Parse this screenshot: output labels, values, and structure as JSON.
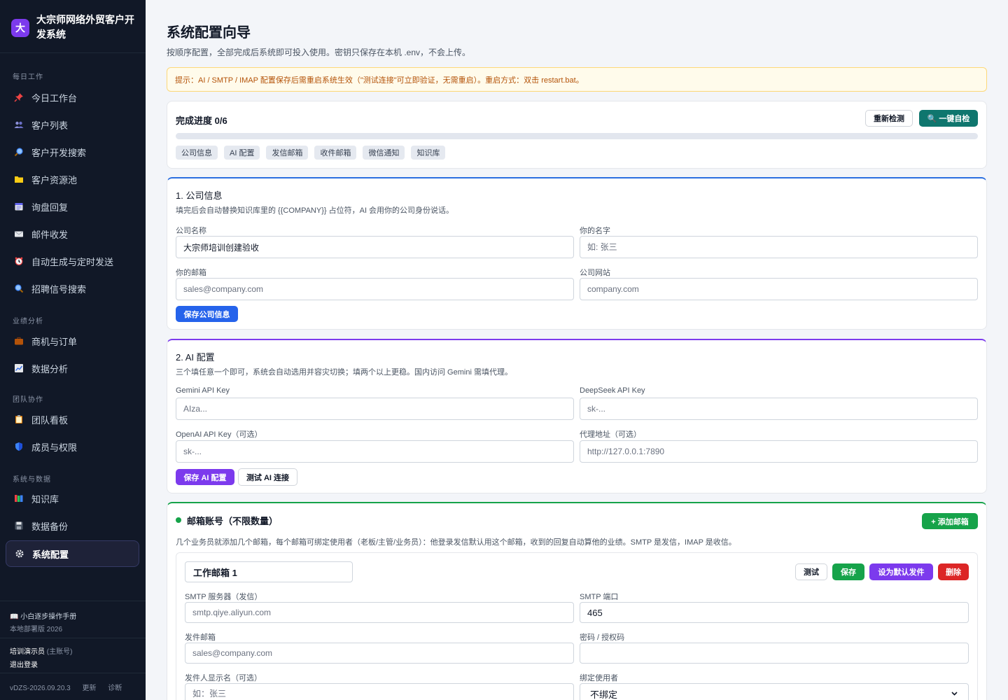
{
  "sidebar": {
    "logo_char": "大",
    "app_title": "大宗师网络外贸客户开发系统",
    "groups": [
      {
        "title": "每日工作",
        "items": [
          "今日工作台",
          "客户列表",
          "客户开发搜索",
          "客户资源池",
          "询盘回复",
          "邮件收发",
          "自动生成与定时发送",
          "招聘信号搜索"
        ]
      },
      {
        "title": "业绩分析",
        "items": [
          "商机与订单",
          "数据分析"
        ]
      },
      {
        "title": "团队协作",
        "items": [
          "团队看板",
          "成员与权限"
        ]
      },
      {
        "title": "系统与数据",
        "items": [
          "知识库",
          "数据备份",
          "系统配置"
        ]
      }
    ],
    "active_item": "系统配置",
    "manual": "📖 小白逐步操作手册",
    "edition": "本地部署版 2026",
    "user_name": "培训演示员",
    "user_role": "(主账号)",
    "logout": "退出登录",
    "version": "vDZS-2026.09.20.3",
    "update": "更新",
    "diagnose": "诊断"
  },
  "header": {
    "title": "系统配置向导",
    "subtitle": "按顺序配置，全部完成后系统即可投入使用。密钥只保存在本机 .env，不会上传。",
    "tip": "提示：AI / SMTP / IMAP 配置保存后需重启系统生效（\"测试连接\"可立即验证，无需重启）。重启方式：双击 restart.bat。"
  },
  "progress": {
    "label": "完成进度 0/6",
    "percent": 0,
    "recheck": "重新检测",
    "self_check": "🔍 一键自检",
    "steps": [
      "公司信息",
      "AI 配置",
      "发信邮箱",
      "收件邮箱",
      "微信通知",
      "知识库"
    ]
  },
  "company": {
    "title": "1. 公司信息",
    "desc": "填完后会自动替换知识库里的 {{COMPANY}} 占位符，AI 会用你的公司身份说话。",
    "name_label": "公司名称",
    "name_value": "大宗师培训创建验收",
    "your_name_label": "你的名字",
    "your_name_placeholder": "如: 张三",
    "email_label": "你的邮箱",
    "email_placeholder": "sales@company.com",
    "website_label": "公司网站",
    "website_placeholder": "company.com",
    "save": "保存公司信息"
  },
  "ai": {
    "title": "2. AI 配置",
    "desc": "三个填任意一个即可，系统会自动选用并容灾切换；填两个以上更稳。国内访问 Gemini 需填代理。",
    "gemini_label": "Gemini API Key",
    "gemini_placeholder": "AIza...",
    "deepseek_label": "DeepSeek API Key",
    "deepseek_placeholder": "sk-...",
    "openai_label": "OpenAI API Key（可选）",
    "openai_placeholder": "sk-...",
    "proxy_label": "代理地址（可选）",
    "proxy_placeholder": "http://127.0.0.1:7890",
    "save": "保存 AI 配置",
    "test": "测试 AI 连接"
  },
  "mail": {
    "title": "邮箱账号（不限数量）",
    "add": "+ 添加邮箱",
    "desc": "几个业务员就添加几个邮箱，每个邮箱可绑定使用者（老板/主管/业务员）：他登录发信默认用这个邮箱，收到的回复自动算他的业绩。SMTP 是发信，IMAP 是收信。",
    "account": {
      "name": "工作邮箱 1",
      "test": "测试",
      "save": "保存",
      "set_default": "设为默认发件",
      "delete": "删除",
      "smtp_server_label": "SMTP 服务器（发信）",
      "smtp_server_placeholder": "smtp.qiye.aliyun.com",
      "smtp_port_label": "SMTP 端口",
      "smtp_port_value": "465",
      "from_email_label": "发件邮箱",
      "from_email_placeholder": "sales@company.com",
      "password_label": "密码 / 授权码",
      "display_name_label": "发件人显示名（可选）",
      "display_name_placeholder": "如：张三",
      "bind_user_label": "绑定使用者",
      "bind_user_value": "不绑定"
    }
  }
}
